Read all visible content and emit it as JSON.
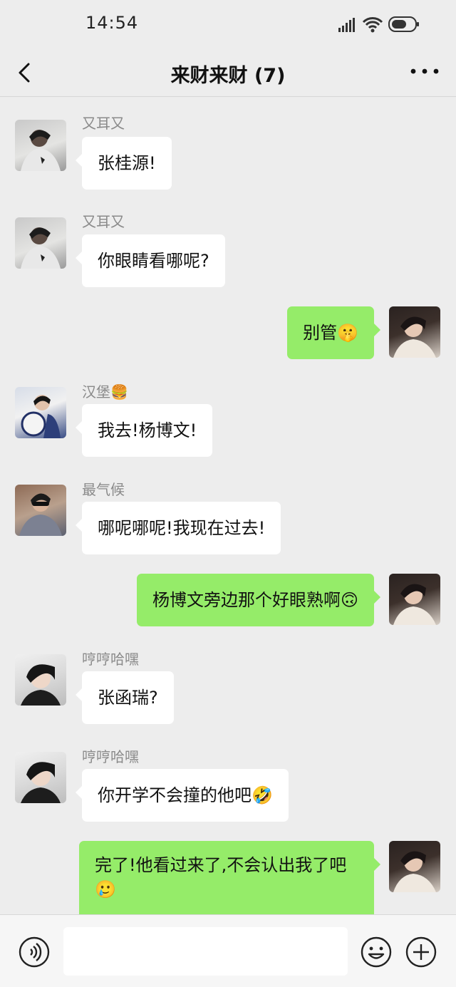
{
  "status_bar": {
    "time": "14:54"
  },
  "header": {
    "title": "来财来财 (7)"
  },
  "messages": [
    {
      "sender": "又耳又",
      "text": "张桂源!"
    },
    {
      "sender": "又耳又",
      "text": "你眼睛看哪呢?"
    },
    {
      "sender": "",
      "text": "别管🤫"
    },
    {
      "sender": "汉堡🍔",
      "text": "我去!杨博文!"
    },
    {
      "sender": "最气候",
      "text": "哪呢哪呢!我现在过去!"
    },
    {
      "sender": "",
      "text": "杨博文旁边那个好眼熟啊🙃"
    },
    {
      "sender": "哼哼哈嘿",
      "text": "张函瑞?"
    },
    {
      "sender": "哼哼哈嘿",
      "text": "你开学不会撞的他吧🤣"
    },
    {
      "sender": "",
      "text": "完了!他看过来了,不会认出我了吧🥲"
    }
  ],
  "input_bar": {
    "placeholder": ""
  },
  "icons": {
    "back": "chevron-left-icon",
    "more": "ellipsis-icon",
    "voice": "voice-icon",
    "emoji": "emoji-icon",
    "plus": "plus-icon"
  },
  "colors": {
    "background": "#ededed",
    "bubble_in": "#ffffff",
    "bubble_out": "#95ec69",
    "sender_name": "#8a8a8a"
  }
}
